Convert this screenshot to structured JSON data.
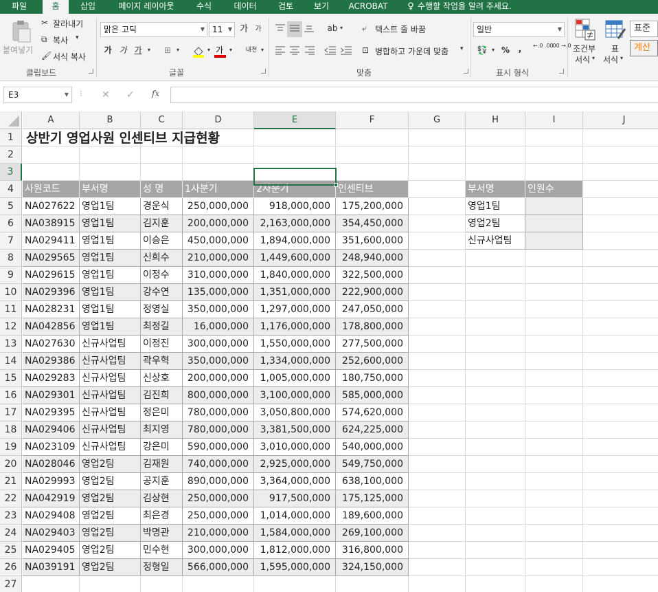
{
  "ribbon_tabs": [
    "파일",
    "홈",
    "삽입",
    "페이지 레이아웃",
    "수식",
    "데이터",
    "검토",
    "보기",
    "ACROBAT",
    "수행할 작업을 알려 주세요."
  ],
  "active_tab": "홈",
  "clipboard": {
    "paste": "붙여넣기",
    "cut": "잘라내기",
    "copy": "복사",
    "format_painter": "서식 복사",
    "group": "클립보드"
  },
  "font": {
    "name": "맑은 고딕",
    "size": "11",
    "bold": "가",
    "italic": "가",
    "underline": "가",
    "grow": "가",
    "shrink": "가",
    "font_color": "가",
    "phonetic": "내천",
    "group": "글꼴"
  },
  "alignment": {
    "wrap_text": "텍스트 줄 바꿈",
    "merge_center": "병합하고 가운데 맞춤",
    "group": "맞춤"
  },
  "number": {
    "format": "일반",
    "percent": "%",
    "comma": ",",
    "inc_decimal": "←.0 .00",
    "dec_decimal": ".00 →.0",
    "group": "표시 형식"
  },
  "styles": {
    "conditional": "조건부",
    "conditional2": "서식",
    "table": "표",
    "table2": "서식",
    "normal": "표준",
    "calc": "계산"
  },
  "formula_bar": {
    "name_box": "E3",
    "cancel": "✕",
    "enter": "✓",
    "fx": "fx",
    "value": ""
  },
  "columns": [
    "A",
    "B",
    "C",
    "D",
    "E",
    "F",
    "G",
    "H",
    "I",
    "J"
  ],
  "selected_column": "E",
  "selected_row": "3",
  "rows": [
    "1",
    "2",
    "3",
    "4",
    "5",
    "6",
    "7",
    "8",
    "9",
    "10",
    "11",
    "12",
    "13",
    "14",
    "15",
    "16",
    "17",
    "18",
    "19",
    "20",
    "21",
    "22",
    "23",
    "24",
    "25",
    "26",
    "27"
  ],
  "sheet": {
    "title": "상반기 영업사원 인센티브 지급현황",
    "headers": [
      "사원코드",
      "부서명",
      "성  명",
      "1사분기",
      "2사분기",
      "인센티브"
    ],
    "data": [
      [
        "NA027622",
        "영업1팀",
        "경운식",
        "250,000,000",
        "918,000,000",
        "175,200,000"
      ],
      [
        "NA038915",
        "영업1팀",
        "김지훈",
        "200,000,000",
        "2,163,000,000",
        "354,450,000"
      ],
      [
        "NA029411",
        "영업1팀",
        "이승은",
        "450,000,000",
        "1,894,000,000",
        "351,600,000"
      ],
      [
        "NA029565",
        "영업1팀",
        "신희수",
        "210,000,000",
        "1,449,600,000",
        "248,940,000"
      ],
      [
        "NA029615",
        "영업1팀",
        "이정수",
        "310,000,000",
        "1,840,000,000",
        "322,500,000"
      ],
      [
        "NA029396",
        "영업1팀",
        "강수연",
        "135,000,000",
        "1,351,000,000",
        "222,900,000"
      ],
      [
        "NA028231",
        "영업1팀",
        "정영실",
        "350,000,000",
        "1,297,000,000",
        "247,050,000"
      ],
      [
        "NA042856",
        "영업1팀",
        "최정길",
        "16,000,000",
        "1,176,000,000",
        "178,800,000"
      ],
      [
        "NA027630",
        "신규사업팀",
        "이정진",
        "300,000,000",
        "1,550,000,000",
        "277,500,000"
      ],
      [
        "NA029386",
        "신규사업팀",
        "곽우혁",
        "350,000,000",
        "1,334,000,000",
        "252,600,000"
      ],
      [
        "NA029283",
        "신규사업팀",
        "신상호",
        "200,000,000",
        "1,005,000,000",
        "180,750,000"
      ],
      [
        "NA029301",
        "신규사업팀",
        "김진희",
        "800,000,000",
        "3,100,000,000",
        "585,000,000"
      ],
      [
        "NA029395",
        "신규사업팀",
        "정은미",
        "780,000,000",
        "3,050,800,000",
        "574,620,000"
      ],
      [
        "NA029406",
        "신규사업팀",
        "최지영",
        "780,000,000",
        "3,381,500,000",
        "624,225,000"
      ],
      [
        "NA023109",
        "신규사업팀",
        "강은미",
        "590,000,000",
        "3,010,000,000",
        "540,000,000"
      ],
      [
        "NA028046",
        "영업2팀",
        "김재원",
        "740,000,000",
        "2,925,000,000",
        "549,750,000"
      ],
      [
        "NA029993",
        "영업2팀",
        "공지훈",
        "890,000,000",
        "3,364,000,000",
        "638,100,000"
      ],
      [
        "NA042919",
        "영업2팀",
        "김상현",
        "250,000,000",
        "917,500,000",
        "175,125,000"
      ],
      [
        "NA029408",
        "영업2팀",
        "최은경",
        "250,000,000",
        "1,014,000,000",
        "189,600,000"
      ],
      [
        "NA029403",
        "영업2팀",
        "박명관",
        "210,000,000",
        "1,584,000,000",
        "269,100,000"
      ],
      [
        "NA029405",
        "영업2팀",
        "민수현",
        "300,000,000",
        "1,812,000,000",
        "316,800,000"
      ],
      [
        "NA039191",
        "영업2팀",
        "정형일",
        "566,000,000",
        "1,595,000,000",
        "324,150,000"
      ]
    ],
    "side_headers": [
      "부서명",
      "인원수"
    ],
    "side_rows": [
      [
        "영업1팀",
        ""
      ],
      [
        "영업2팀",
        ""
      ],
      [
        "신규사업팀",
        ""
      ]
    ]
  },
  "colors": {
    "excel_green": "#217346",
    "header_gray": "#a6a6a6",
    "alt_row": "#ededed"
  }
}
